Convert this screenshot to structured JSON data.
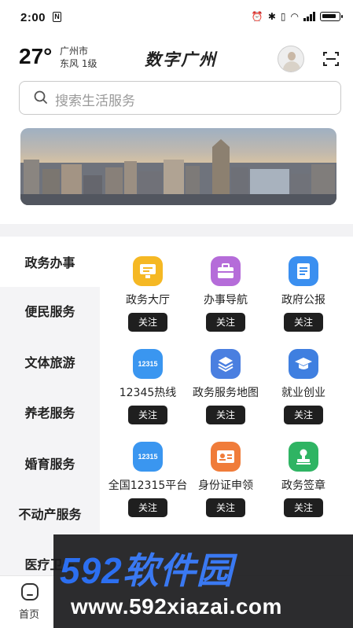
{
  "status_bar": {
    "time": "2:00",
    "nfc": "N"
  },
  "header": {
    "temperature": "27°",
    "city": "广州市",
    "wind": "东风 1级",
    "title": "数字广州"
  },
  "search": {
    "placeholder": "搜索生活服务"
  },
  "sidebar": {
    "items": [
      {
        "label": "政务办事"
      },
      {
        "label": "便民服务"
      },
      {
        "label": "文体旅游"
      },
      {
        "label": "养老服务"
      },
      {
        "label": "婚育服务"
      },
      {
        "label": "不动产服务"
      },
      {
        "label": "医疗卫生"
      }
    ]
  },
  "services": [
    {
      "label": "政务大厅",
      "button": "关注",
      "icon": "monitor-icon",
      "color": "#f5b824"
    },
    {
      "label": "办事导航",
      "button": "关注",
      "icon": "briefcase-icon",
      "color": "#b56cd9"
    },
    {
      "label": "政府公报",
      "button": "关注",
      "icon": "document-icon",
      "color": "#3a8ff0"
    },
    {
      "label": "12345热线",
      "button": "关注",
      "icon": "hotline-icon",
      "color": "#3a96f0",
      "icon_text": "12315"
    },
    {
      "label": "政务服务地图",
      "button": "关注",
      "icon": "layers-icon",
      "color": "#4a7fe0"
    },
    {
      "label": "就业创业",
      "button": "关注",
      "icon": "graduation-cap-icon",
      "color": "#3f7fe0"
    },
    {
      "label": "全国12315平台",
      "button": "关注",
      "icon": "hotline-icon",
      "color": "#3a96f0",
      "icon_text": "12315"
    },
    {
      "label": "身份证申领",
      "button": "关注",
      "icon": "id-card-icon",
      "color": "#f07c3a"
    },
    {
      "label": "政务签章",
      "button": "关注",
      "icon": "seal-icon",
      "color": "#2fb463"
    }
  ],
  "bottom_nav": {
    "home": "首页"
  },
  "watermark": {
    "brand_num": "592",
    "brand_cn": "软件园",
    "url": "www.592xiazai.com"
  }
}
